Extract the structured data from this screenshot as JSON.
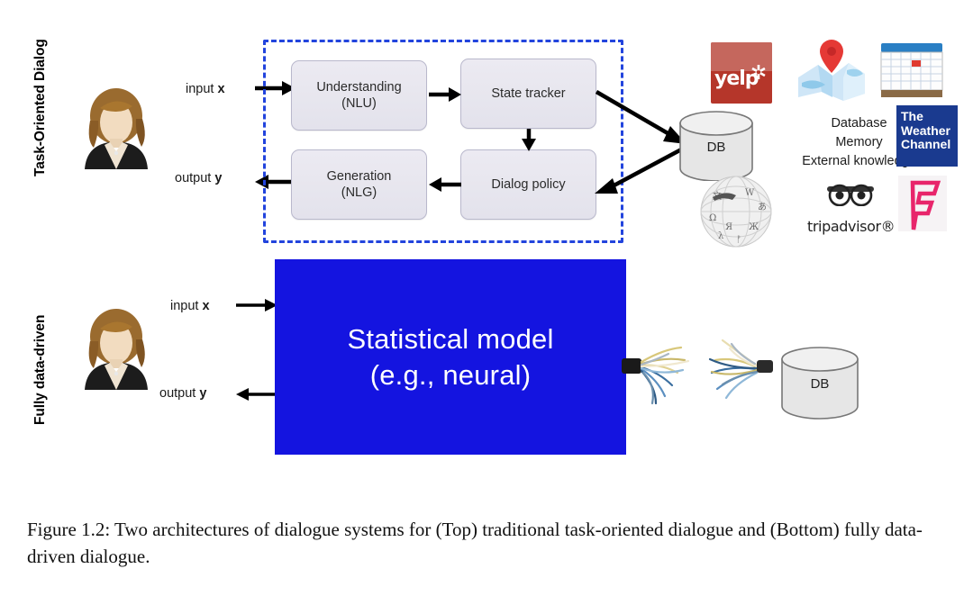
{
  "figure": {
    "caption": "Figure 1.2: Two architectures of dialogue systems for (Top) traditional task-oriented dialogue and (Bottom) fully data-driven dialogue."
  },
  "sections": {
    "top": {
      "label": "Task-Oriented Dialog",
      "avatar_name": "user-avatar",
      "input_label_prefix": "input ",
      "input_label_var": "x",
      "output_label_prefix": "output ",
      "output_label_var": "y",
      "modules": [
        {
          "id": "nlu",
          "line1": "Understanding",
          "line2": "(NLU)"
        },
        {
          "id": "state-tracker",
          "line1": "State tracker",
          "line2": ""
        },
        {
          "id": "dialog-policy",
          "line1": "Dialog policy",
          "line2": ""
        },
        {
          "id": "nlg",
          "line1": "Generation",
          "line2": "(NLG)"
        }
      ],
      "database": {
        "label": "DB"
      },
      "knowledge": {
        "line1": "Database",
        "line2": "Memory",
        "line3": "External knowledge"
      },
      "logos": [
        {
          "name": "yelp",
          "word": "yelp",
          "burst": "✲",
          "bg": "#b5362a"
        },
        {
          "name": "maps",
          "word": "",
          "bg": "#cfe4f5"
        },
        {
          "name": "calendar",
          "word": "",
          "bg": "#f2f2f2"
        },
        {
          "name": "weather-channel",
          "line1": "The",
          "line2": "Weather",
          "line3": "Channel",
          "bg": "#1a3a8f"
        },
        {
          "name": "wikipedia",
          "word": "",
          "bg": "#e8e8e8"
        },
        {
          "name": "tripadvisor",
          "word": "tripadvisor®",
          "bg": "#ffffff"
        },
        {
          "name": "foursquare",
          "word": "",
          "bg": "#f6f3f5"
        }
      ]
    },
    "bottom": {
      "label": "Fully data-driven",
      "avatar_name": "user-avatar",
      "input_label_prefix": "input ",
      "input_label_var": "x",
      "output_label_prefix": "output ",
      "output_label_var": "y",
      "model": {
        "line1": "Statistical model",
        "line2": "(e.g., neural)",
        "color": "#1414e0",
        "text_color": "#ffffff"
      },
      "database": {
        "label": "DB"
      }
    }
  },
  "colors": {
    "dashed_border": "#2244dd",
    "model_blue": "#1414e0",
    "module_fill": "#e9e8f0",
    "module_stroke": "#b9b8cc",
    "arrow": "#000000",
    "db_fill": "#e3e3e3"
  }
}
